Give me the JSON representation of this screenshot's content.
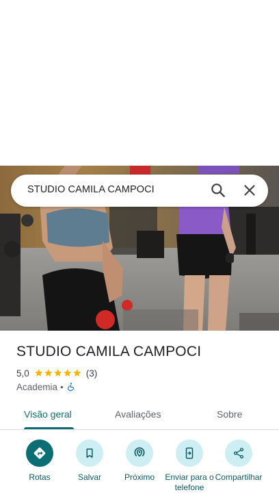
{
  "search": {
    "query": "STUDIO CAMILA CAMPOCI"
  },
  "place": {
    "name": "STUDIO CAMILA CAMPOCI",
    "rating": "5,0",
    "rating_value": 5,
    "review_count": "(3)",
    "category": "Academia",
    "separator": "•"
  },
  "tabs": [
    {
      "label": "Visão geral",
      "active": true
    },
    {
      "label": "Avaliações",
      "active": false
    },
    {
      "label": "Sobre",
      "active": false
    }
  ],
  "actions": [
    {
      "label": "Rotas",
      "icon": "directions-icon"
    },
    {
      "label": "Salvar",
      "icon": "bookmark-icon"
    },
    {
      "label": "Próximo",
      "icon": "nearby-icon"
    },
    {
      "label": "Enviar para o telefone",
      "icon": "send-to-phone-icon"
    },
    {
      "label": "Compartilhar",
      "icon": "share-icon"
    }
  ],
  "colors": {
    "accent": "#0b6e74",
    "action_bg": "#cdeff4",
    "star": "#f5b400",
    "access": "#1a73e8"
  }
}
